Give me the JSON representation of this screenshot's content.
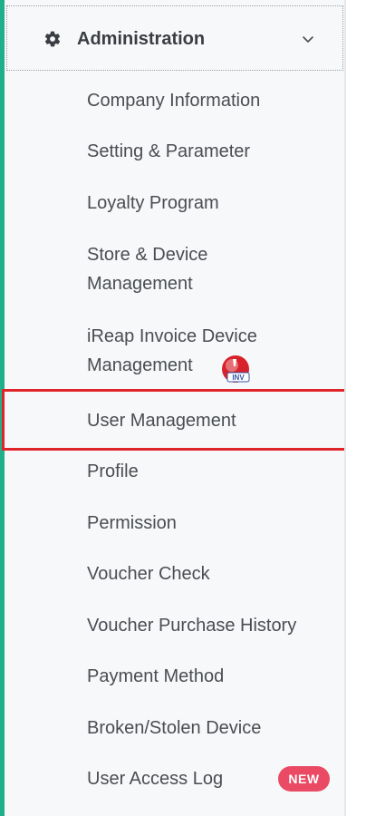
{
  "section": {
    "title": "Administration",
    "icon": "gear-icon",
    "expand_icon": "chevron-down-icon"
  },
  "menu": {
    "items": [
      {
        "label": "Company Information"
      },
      {
        "label": "Setting & Parameter"
      },
      {
        "label": "Loyalty Program"
      },
      {
        "label": "Store & Device Management"
      },
      {
        "label": "iReap Invoice Device Management",
        "badge_icon": "inv-badge-icon",
        "badge_text": "INV"
      },
      {
        "label": "User Management",
        "highlighted": true
      },
      {
        "label": "Profile"
      },
      {
        "label": "Permission"
      },
      {
        "label": "Voucher Check"
      },
      {
        "label": "Voucher Purchase History"
      },
      {
        "label": "Payment Method"
      },
      {
        "label": "Broken/Stolen Device"
      },
      {
        "label": "User Access Log",
        "badge": "NEW"
      }
    ]
  },
  "colors": {
    "accent": "#1fb08a",
    "highlight": "#e0242a",
    "new_badge": "#ea4a63",
    "sidebar_bg": "#f7f8fa",
    "text": "#4a4d52"
  }
}
